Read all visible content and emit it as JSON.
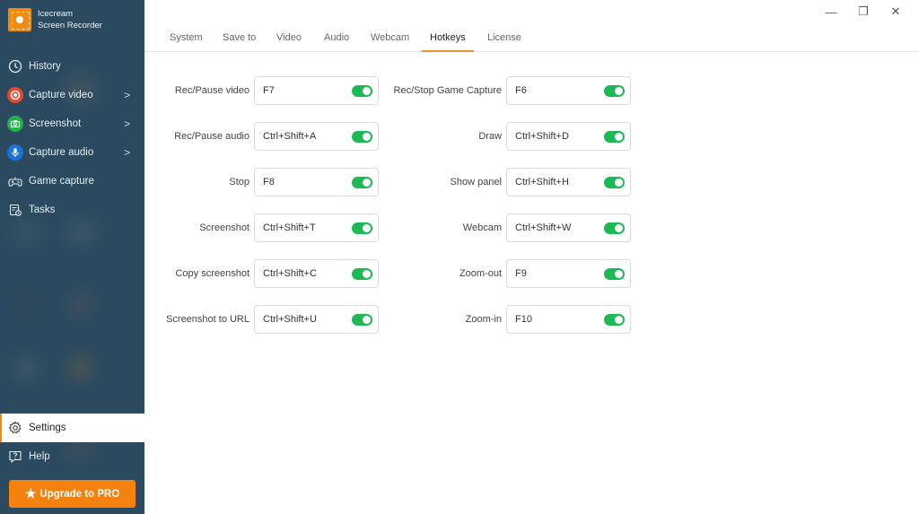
{
  "app": {
    "brand_line1": "Icecream",
    "brand_line2": "Screen Recorder"
  },
  "sidebar": {
    "items": [
      {
        "label": "History",
        "icon": "clock-icon",
        "chevron": false
      },
      {
        "label": "Capture video",
        "icon": "record-icon",
        "chevron": true,
        "color": "#e8452c"
      },
      {
        "label": "Screenshot",
        "icon": "camera-icon",
        "chevron": true,
        "color": "#21b14a"
      },
      {
        "label": "Capture audio",
        "icon": "microphone-icon",
        "chevron": true,
        "color": "#1a73d9"
      },
      {
        "label": "Game capture",
        "icon": "gamepad-icon",
        "chevron": false
      },
      {
        "label": "Tasks",
        "icon": "tasks-icon",
        "chevron": false
      }
    ],
    "bottom_items": [
      {
        "label": "Settings",
        "icon": "gear-icon",
        "active": true
      },
      {
        "label": "Help",
        "icon": "help-icon",
        "active": false
      }
    ],
    "chevron_glyph": ">",
    "upgrade_label": "Upgrade to PRO",
    "upgrade_icon": "★"
  },
  "window": {
    "minimize": "—",
    "restore": "❐",
    "close": "✕"
  },
  "tabs": [
    {
      "label": "System",
      "active": false
    },
    {
      "label": "Save to",
      "active": false
    },
    {
      "label": "Video",
      "active": false
    },
    {
      "label": "Audio",
      "active": false
    },
    {
      "label": "Webcam",
      "active": false
    },
    {
      "label": "Hotkeys",
      "active": true
    },
    {
      "label": "License",
      "active": false
    }
  ],
  "hotkeys": {
    "left": [
      {
        "label": "Rec/Pause video",
        "value": "F7",
        "enabled": true
      },
      {
        "label": "Rec/Pause audio",
        "value": "Ctrl+Shift+A",
        "enabled": true
      },
      {
        "label": "Stop",
        "value": "F8",
        "enabled": true
      },
      {
        "label": "Screenshot",
        "value": "Ctrl+Shift+T",
        "enabled": true
      },
      {
        "label": "Copy screenshot",
        "value": "Ctrl+Shift+C",
        "enabled": true
      },
      {
        "label": "Screenshot to URL",
        "value": "Ctrl+Shift+U",
        "enabled": true
      }
    ],
    "right": [
      {
        "label": "Rec/Stop Game Capture",
        "value": "F6",
        "enabled": true
      },
      {
        "label": "Draw",
        "value": "Ctrl+Shift+D",
        "enabled": true
      },
      {
        "label": "Show panel",
        "value": "Ctrl+Shift+H",
        "enabled": true
      },
      {
        "label": "Webcam",
        "value": "Ctrl+Shift+W",
        "enabled": true
      },
      {
        "label": "Zoom-out",
        "value": "F9",
        "enabled": true
      },
      {
        "label": "Zoom-in",
        "value": "F10",
        "enabled": true
      }
    ]
  },
  "colors": {
    "accent": "#f5820f",
    "toggle_on": "#1db954",
    "sidebar_bg": "#2b4a5f"
  }
}
